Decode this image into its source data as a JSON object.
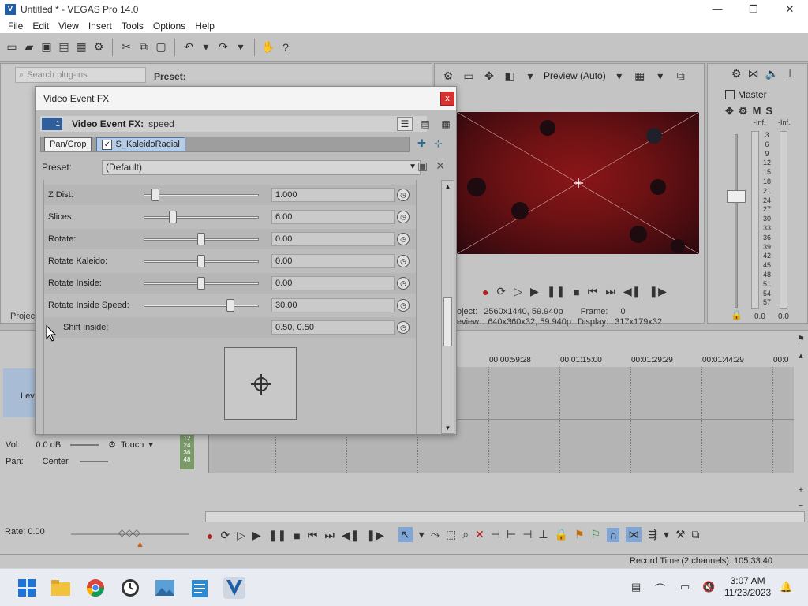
{
  "window": {
    "title": "Untitled * - VEGAS Pro 14.0",
    "app_logo": "V",
    "minimize_icon": "—",
    "maximize_icon": "❐",
    "close_icon": "✕"
  },
  "menu": [
    "File",
    "Edit",
    "View",
    "Insert",
    "Tools",
    "Options",
    "Help"
  ],
  "explorer": {
    "search_placeholder": "Search plug-ins",
    "preset_label": "Preset:",
    "tab_stub": "Projec"
  },
  "preview": {
    "quality": "Preview (Auto)",
    "project": "oject:",
    "project_val": "2560x1440, 59.940p",
    "frame_lbl": "Frame:",
    "frame_val": "0",
    "preview_lbl": "eview:",
    "preview_val": "640x360x32, 59.940p",
    "display_lbl": "Display:",
    "display_val": "317x179x32"
  },
  "master": {
    "title": "Master",
    "m_label": "M",
    "s_label": "S",
    "peak_left": "-Inf.",
    "peak_right": "-Inf.",
    "scale": [
      "3",
      "6",
      "9",
      "12",
      "15",
      "18",
      "21",
      "24",
      "27",
      "30",
      "33",
      "36",
      "39",
      "42",
      "45",
      "48",
      "51",
      "54",
      "57"
    ],
    "bottom_left": "0.0",
    "bottom_right": "0.0"
  },
  "fx": {
    "dialog_title": "Video Event FX",
    "close": "x",
    "index": "1",
    "header_name": "Video Event FX:",
    "header_value": "speed",
    "chain": [
      {
        "label": "Pan/Crop",
        "active": false
      },
      {
        "label": "S_KaleidoRadial",
        "active": true
      }
    ],
    "preset_label": "Preset:",
    "preset_value": "(Default)",
    "params": [
      {
        "label": "Z Dist:",
        "value": "1.000",
        "level": 0.1
      },
      {
        "label": "Slices:",
        "value": "6.00",
        "level": 0.25
      },
      {
        "label": "Rotate:",
        "value": "0.00",
        "level": 0.5
      },
      {
        "label": "Rotate Kaleido:",
        "value": "0.00",
        "level": 0.5
      },
      {
        "label": "Rotate Inside:",
        "value": "0.00",
        "level": 0.5
      },
      {
        "label": "Rotate Inside Speed:",
        "value": "30.00",
        "level": 0.75
      },
      {
        "label": "Shift Inside:",
        "value": "0.50, 0.50",
        "level": null
      }
    ]
  },
  "timeline": {
    "ruler": [
      "00:00:59:28",
      "00:01:15:00",
      "00:01:29:29",
      "00:01:44:29",
      "00:0"
    ],
    "track1_label": "Lev",
    "vol_label": "Vol:",
    "vol_value": "0.0 dB",
    "touch_label": "Touch",
    "pan_label": "Pan:",
    "pan_value": "Center",
    "mini_scale": [
      "12",
      "24",
      "36",
      "48"
    ]
  },
  "bottom": {
    "rate_label": "Rate: 0.00",
    "record_time": "Record Time (2 channels): 105:33:40"
  },
  "taskbar": {
    "time": "3:07 AM",
    "date": "11/23/2023"
  }
}
